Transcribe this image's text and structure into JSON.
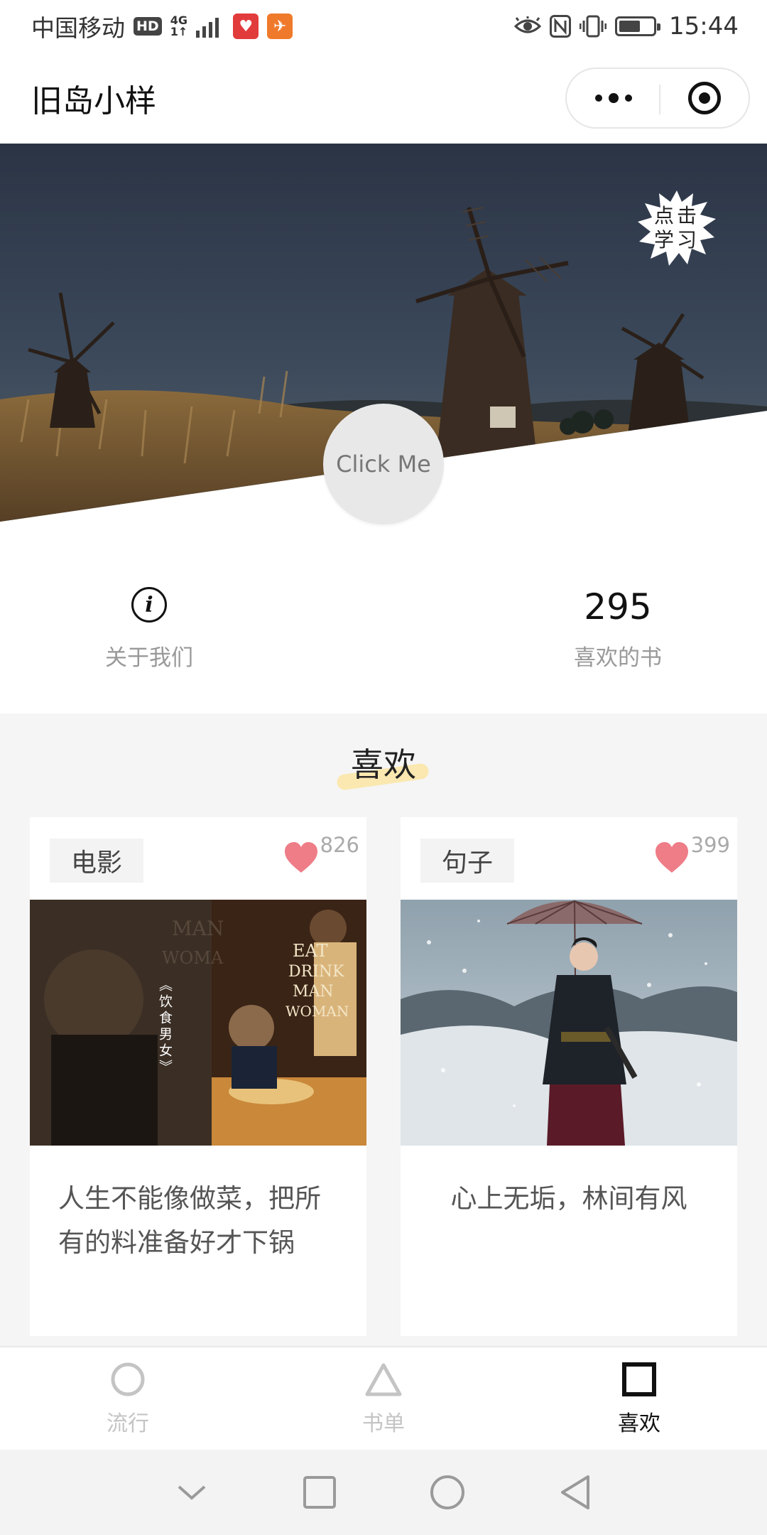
{
  "status_bar": {
    "carrier": "中国移动",
    "hd_badge": "HD",
    "network_top": "4G",
    "network_bottom": "1↑",
    "time": "15:44",
    "battery_level": 0.62,
    "icons": [
      "signal-icon",
      "app-red-icon",
      "app-orange-icon",
      "eye-icon",
      "nfc-icon",
      "vibrate-icon",
      "battery-icon"
    ]
  },
  "title_bar": {
    "title": "旧岛小样",
    "menu_icon": "more-dots-icon",
    "close_icon": "target-icon"
  },
  "hero": {
    "stamp_text": "点击学习",
    "button_label": "Click Me"
  },
  "stats": {
    "about_label": "关于我们",
    "about_icon": "info-icon",
    "likes_count": "295",
    "likes_label": "喜欢的书"
  },
  "favorites": {
    "title": "喜欢",
    "cards": [
      {
        "tag": "电影",
        "like_count": "826",
        "image_text": "《饮食男女》",
        "text": "人生不能像做菜，把所有的料准备好才下锅"
      },
      {
        "tag": "句子",
        "like_count": "399",
        "text": "心上无垢，林间有风"
      }
    ]
  },
  "tab_bar": {
    "tabs": [
      {
        "label": "流行",
        "icon": "circle-icon",
        "active": false
      },
      {
        "label": "书单",
        "icon": "triangle-icon",
        "active": false
      },
      {
        "label": "喜欢",
        "icon": "square-icon",
        "active": true
      }
    ]
  },
  "colors": {
    "heart": "#ee7d88",
    "tab_inactive": "#c4c4c4",
    "tab_active": "#111111",
    "section_bg": "#f5f5f5"
  }
}
